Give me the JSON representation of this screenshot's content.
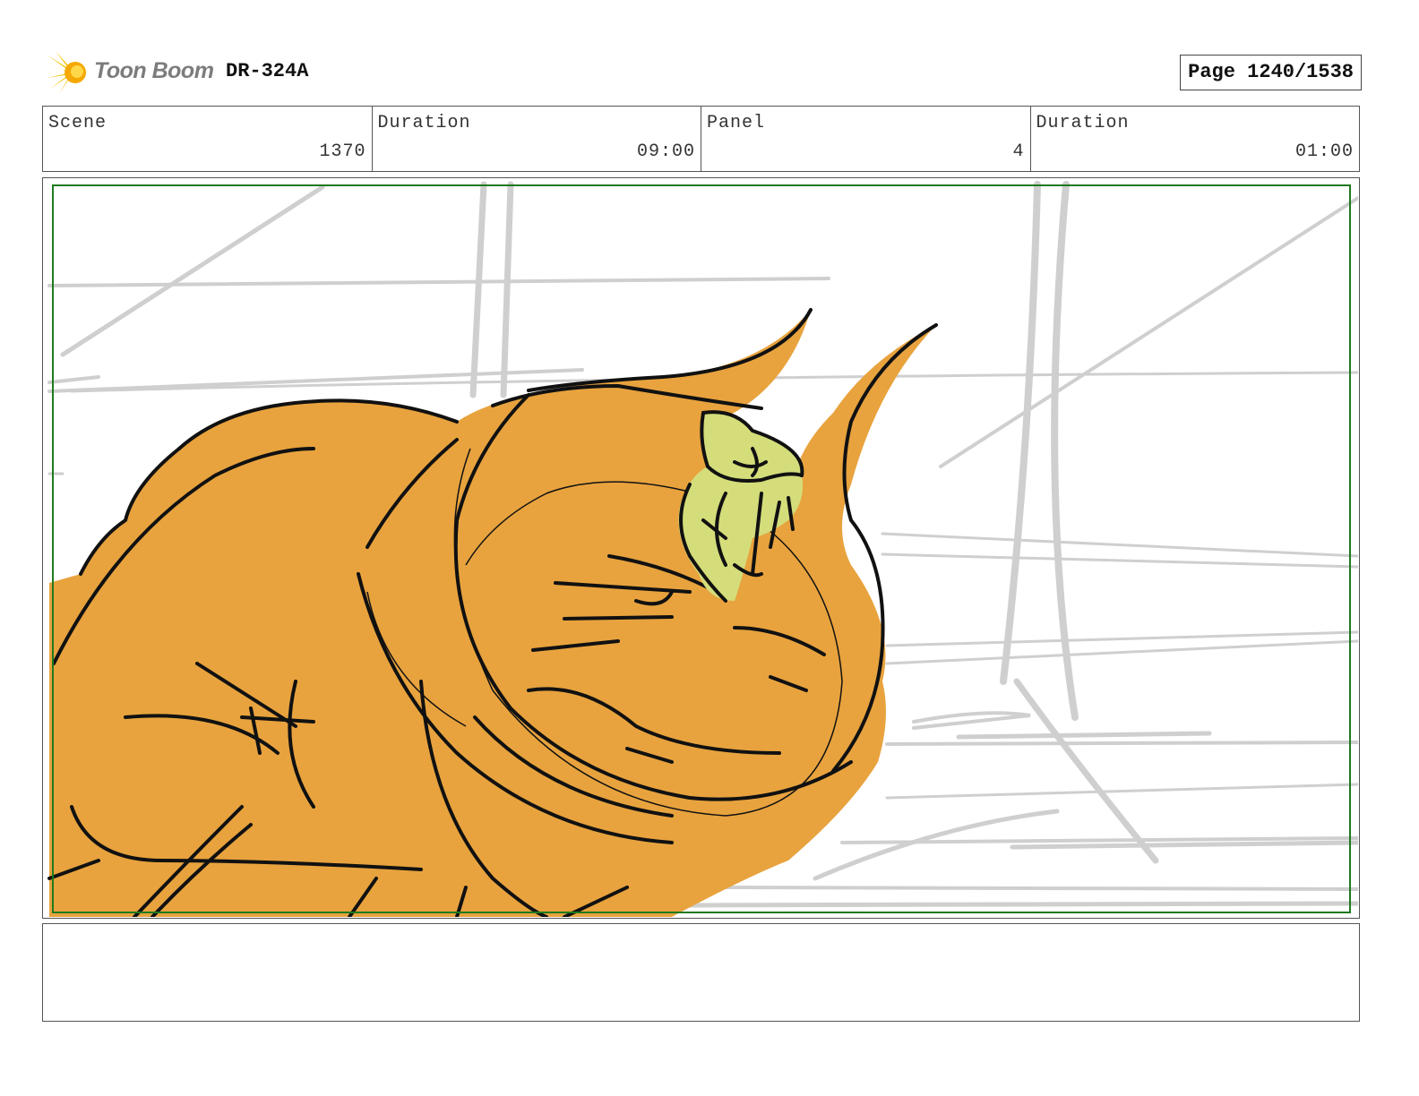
{
  "header": {
    "logo_text": "Toon Boom",
    "project_id": "DR-324A",
    "page_label": "Page 1240/1538"
  },
  "info": {
    "scene_label": "Scene",
    "scene_value": "1370",
    "scene_duration_label": "Duration",
    "scene_duration_value": "09:00",
    "panel_label": "Panel",
    "panel_value": "4",
    "panel_duration_label": "Duration",
    "panel_duration_value": "01:00"
  },
  "panel": {
    "safe_frame_color": "#1f7a1f",
    "creature_color": "#e8a33e",
    "rider_color": "#d4dd7a",
    "background_line_color": "#cfcfcf",
    "ink_color": "#111111"
  },
  "notes": {
    "text": ""
  }
}
